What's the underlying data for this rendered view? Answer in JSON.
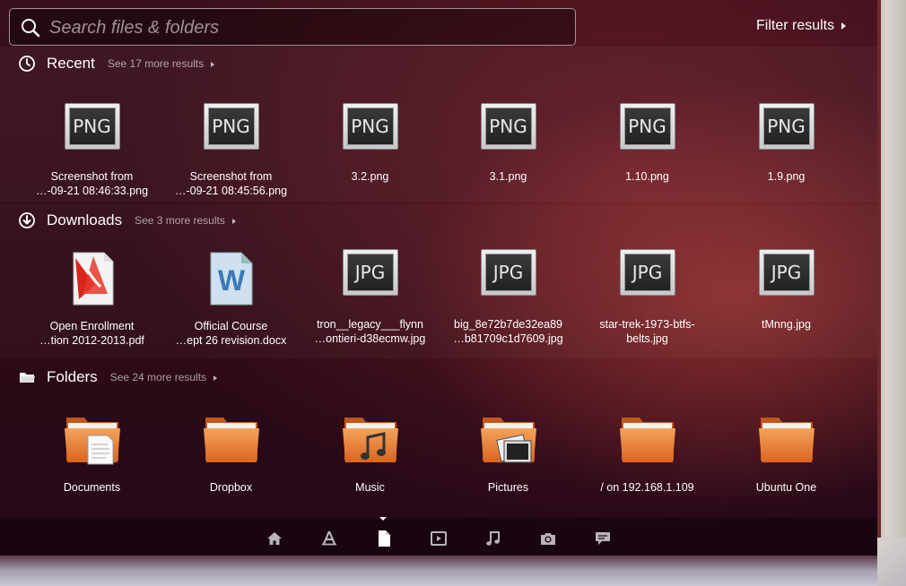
{
  "search": {
    "placeholder": "Search files & folders",
    "value": ""
  },
  "filter": {
    "label": "Filter results"
  },
  "sections": {
    "recent": {
      "title": "Recent",
      "more": "See 17 more results",
      "items": [
        {
          "label": "Screenshot from\n…-09-21 08:46:33.png",
          "icon": "png-file-icon",
          "badge": "PNG"
        },
        {
          "label": "Screenshot from\n…-09-21 08:45:56.png",
          "icon": "png-file-icon",
          "badge": "PNG"
        },
        {
          "label": "3.2.png",
          "icon": "png-file-icon",
          "badge": "PNG"
        },
        {
          "label": "3.1.png",
          "icon": "png-file-icon",
          "badge": "PNG"
        },
        {
          "label": "1.10.png",
          "icon": "png-file-icon",
          "badge": "PNG"
        },
        {
          "label": "1.9.png",
          "icon": "png-file-icon",
          "badge": "PNG"
        }
      ]
    },
    "downloads": {
      "title": "Downloads",
      "more": "See 3 more results",
      "items": [
        {
          "label": "Open Enrollment\n…tion 2012-2013.pdf",
          "icon": "pdf-file-icon"
        },
        {
          "label": "Official Course\n…ept 26 revision.docx",
          "icon": "word-file-icon",
          "badge": "W"
        },
        {
          "label": "tron__legacy___flynn\n…ontieri-d38ecmw.jpg",
          "icon": "jpg-file-icon",
          "badge": "JPG"
        },
        {
          "label": "big_8e72b7de32ea89\n…b81709c1d7609.jpg",
          "icon": "jpg-file-icon",
          "badge": "JPG"
        },
        {
          "label": "star-trek-1973-btfs-\nbelts.jpg",
          "icon": "jpg-file-icon",
          "badge": "JPG"
        },
        {
          "label": "tMnng.jpg",
          "icon": "jpg-file-icon",
          "badge": "JPG"
        }
      ]
    },
    "folders": {
      "title": "Folders",
      "more": "See 24 more results",
      "items": [
        {
          "label": "Documents",
          "icon": "documents-folder-icon"
        },
        {
          "label": "Dropbox",
          "icon": "folder-icon"
        },
        {
          "label": "Music",
          "icon": "music-folder-icon"
        },
        {
          "label": "Pictures",
          "icon": "pictures-folder-icon"
        },
        {
          "label": "/ on 192.168.1.109",
          "icon": "folder-icon"
        },
        {
          "label": "Ubuntu One",
          "icon": "folder-icon"
        }
      ]
    }
  },
  "lenses": [
    "home-lens-icon",
    "applications-lens-icon",
    "files-lens-icon",
    "video-lens-icon",
    "music-lens-icon",
    "photos-lens-icon",
    "social-lens-icon"
  ],
  "active_lens": "files-lens-icon"
}
